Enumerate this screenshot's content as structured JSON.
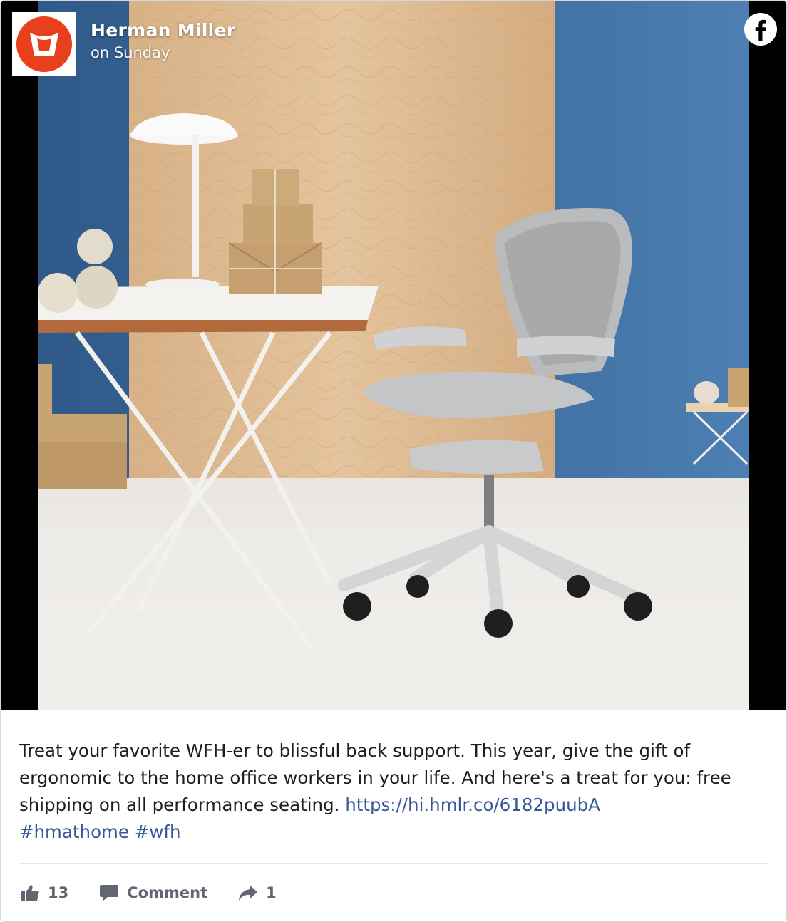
{
  "post": {
    "author": "Herman Miller",
    "time": "on Sunday",
    "platform_icon": "facebook-icon",
    "caption_text": "Treat your favorite WFH-er to blissful back support. This year, give the gift of ergonomic to the home office workers in your life. And here's a treat for you: free shipping on all performance seating.",
    "link": "https://hi.hmlr.co/6182puubA",
    "hashtags": [
      "#hmathome",
      "#wfh"
    ]
  },
  "actions": {
    "likes": "13",
    "comment_label": "Comment",
    "shares": "1"
  },
  "colors": {
    "brand": "#e8401c",
    "link": "#385898",
    "wall": "#3f6c9c",
    "wood": "#dcb78e"
  }
}
